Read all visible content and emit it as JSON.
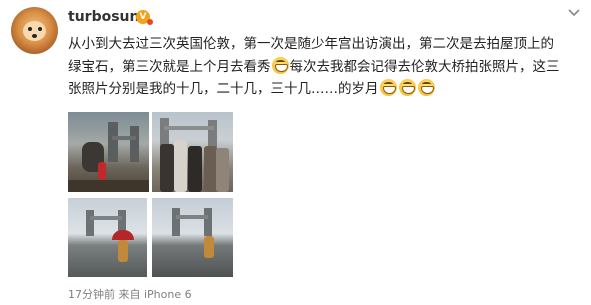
{
  "post": {
    "username": "turbosun",
    "vip_badge": "V",
    "content_lines": [
      "从小到大去过三次英国伦敦，第一次是随少年宫出访演出，第二次是去拍屋顶上的",
      {
        "before": "绿宝石，第三次就是上个月去看秀",
        "after": "每次去我都会记得去伦敦大桥拍张照片，这三"
      },
      {
        "before": "张照片分别是我的十几，二十几，三十几……的岁月",
        "after": ""
      }
    ],
    "emoji_name": "grin-emoji",
    "footer": "17分钟前 来自 iPhone 6"
  },
  "photos": [
    {
      "name": "photo-statue-tower-bridge"
    },
    {
      "name": "photo-group-tower-bridge"
    },
    {
      "name": "photo-child-umbrella-tower-bridge"
    },
    {
      "name": "photo-child-tower-bridge"
    }
  ],
  "icons": {
    "menu": "chevron-down-icon",
    "avatar": "dog-avatar"
  },
  "colors": {
    "text": "#222222",
    "meta": "#808080",
    "username": "#333333",
    "badge": "#f4a01a"
  }
}
